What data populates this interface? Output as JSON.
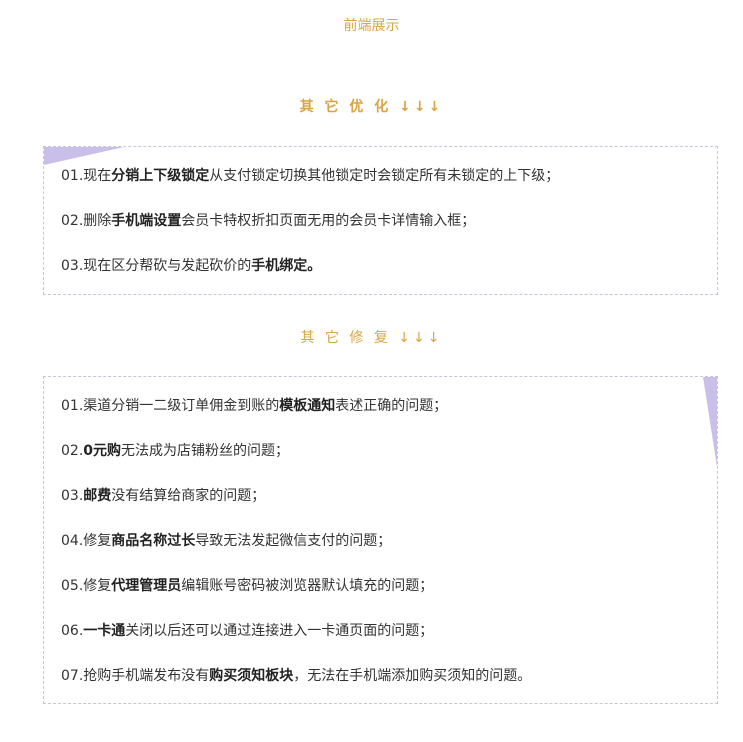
{
  "top_title": "前端展示",
  "sections": [
    {
      "title": "其 它 优 化 ↓↓↓",
      "items": [
        {
          "prefix": "01.现在",
          "bold": "分销上下级锁定",
          "suffix": "从支付锁定切换其他锁定时会锁定所有未锁定的上下级；"
        },
        {
          "prefix": "02.删除",
          "bold": "手机端设置",
          "suffix": "会员卡特权折扣页面无用的会员卡详情输入框；"
        },
        {
          "prefix": "03.现在区分帮砍与发起砍价的",
          "bold": "手机绑定。",
          "suffix": ""
        }
      ]
    },
    {
      "title": "其 它 修 复 ↓↓↓",
      "items": [
        {
          "prefix": "01.渠道分销一二级订单佣金到账的",
          "bold": "模板通知",
          "suffix": "表述正确的问题；"
        },
        {
          "prefix": "02.",
          "bold": "0元购",
          "suffix": "无法成为店铺粉丝的问题；"
        },
        {
          "prefix": "03.",
          "bold": "邮费",
          "suffix": "没有结算给商家的问题；"
        },
        {
          "prefix": "04.修复",
          "bold": "商品名称过长",
          "suffix": "导致无法发起微信支付的问题；"
        },
        {
          "prefix": "05.修复",
          "bold": "代理管理员",
          "suffix": "编辑账号密码被浏览器默认填充的问题；"
        },
        {
          "prefix": "06.",
          "bold": "一卡通",
          "suffix": "关闭以后还可以通过连接进入一卡通页面的问题；"
        },
        {
          "prefix": "07.抢购手机端发布没有",
          "bold": "购买须知板块",
          "suffix": "，无法在手机端添加购买须知的问题。"
        }
      ]
    }
  ],
  "colors": {
    "accent": "#d9a441",
    "border": "#c9c4dc",
    "decoration": "#c9bfe8",
    "text": "#333333"
  }
}
